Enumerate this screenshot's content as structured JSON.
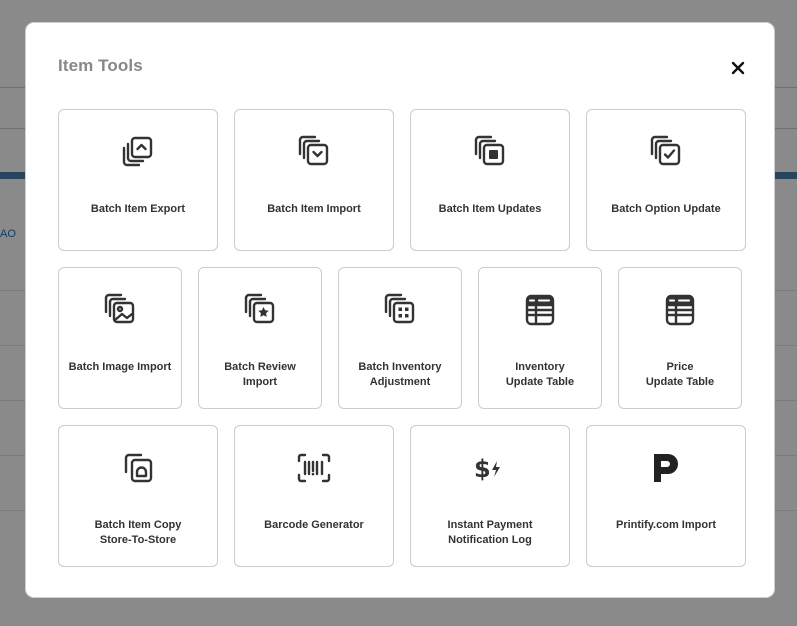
{
  "background": {
    "link_text": "AO"
  },
  "modal": {
    "title": "Item Tools",
    "close_icon": "close-icon"
  },
  "tools": [
    {
      "label_lines": [
        "Batch Item Export"
      ],
      "icon": "stack-upload-icon"
    },
    {
      "label_lines": [
        "Batch Item Import"
      ],
      "icon": "stack-download-icon"
    },
    {
      "label_lines": [
        "Batch Item Updates"
      ],
      "icon": "stack-square-icon"
    },
    {
      "label_lines": [
        "Batch Option Update"
      ],
      "icon": "stack-check-icon"
    },
    {
      "label_lines": [
        "Batch Image Import"
      ],
      "icon": "stack-image-icon"
    },
    {
      "label_lines": [
        "Batch Review",
        "Import"
      ],
      "icon": "stack-star-icon"
    },
    {
      "label_lines": [
        "Batch Inventory",
        "Adjustment"
      ],
      "icon": "stack-grid-icon"
    },
    {
      "label_lines": [
        "Inventory",
        "Update Table"
      ],
      "icon": "table-list-icon"
    },
    {
      "label_lines": [
        "Price",
        "Update Table"
      ],
      "icon": "table-list-icon"
    },
    {
      "label_lines": [
        "Batch Item Copy",
        "Store-To-Store"
      ],
      "icon": "copy-store-icon"
    },
    {
      "label_lines": [
        "Barcode Generator"
      ],
      "icon": "barcode-icon"
    },
    {
      "label_lines": [
        "Instant Payment",
        "Notification Log"
      ],
      "icon": "dollar-bolt-icon"
    },
    {
      "label_lines": [
        "Printify.com Import"
      ],
      "icon": "printify-logo-icon"
    }
  ],
  "colors": {
    "overlay": "#000000",
    "card_border": "#cccccc",
    "icon": "#333333",
    "title": "#888888"
  }
}
